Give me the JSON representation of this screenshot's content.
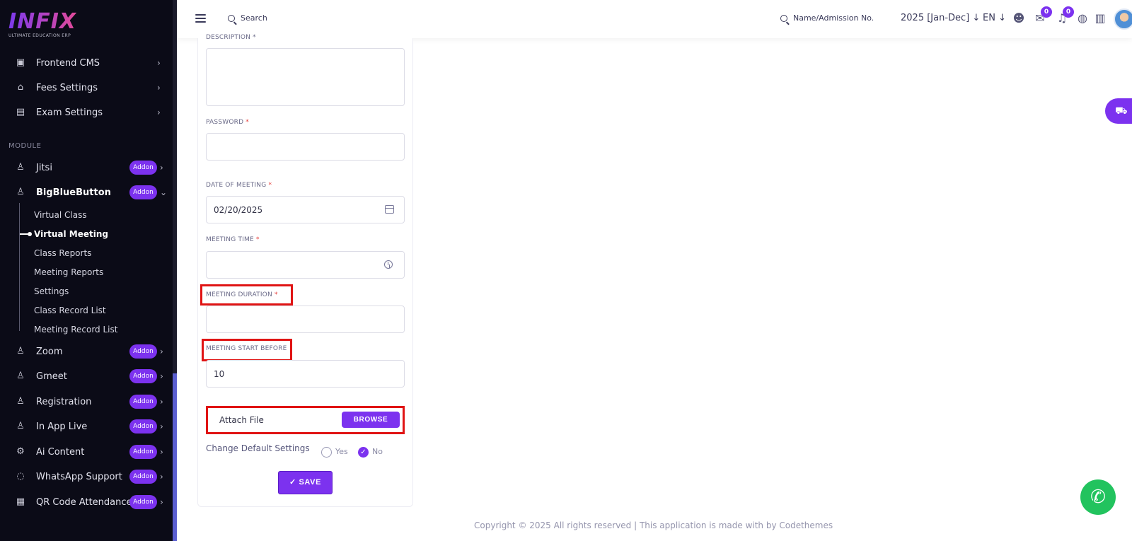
{
  "app": {
    "logo_text": "INFIX",
    "logo_tagline": "ULTIMATE EDUCATION ERP"
  },
  "sidebar": {
    "top_items": [
      {
        "label": "Frontend CMS",
        "icon": "monitor-icon"
      },
      {
        "label": "Fees Settings",
        "icon": "bank-icon"
      },
      {
        "label": "Exam Settings",
        "icon": "book-icon"
      }
    ],
    "module_label": "MODULE",
    "addon_label": "Addon",
    "modules": [
      {
        "label": "Jitsi"
      },
      {
        "label": "BigBlueButton"
      },
      {
        "label": "Zoom"
      },
      {
        "label": "Gmeet"
      },
      {
        "label": "Registration"
      },
      {
        "label": "In App Live"
      },
      {
        "label": "Ai Content"
      },
      {
        "label": "WhatsApp Support"
      },
      {
        "label": "QR Code Attendance"
      }
    ],
    "submenu": [
      {
        "label": "Virtual Class"
      },
      {
        "label": "Virtual Meeting"
      },
      {
        "label": "Class Reports"
      },
      {
        "label": "Meeting Reports"
      },
      {
        "label": "Settings"
      },
      {
        "label": "Class Record List"
      },
      {
        "label": "Meeting Record List"
      }
    ]
  },
  "topbar": {
    "search_placeholder": "Search",
    "admission_search": "Name/Admission No.",
    "academic_year": "2025 [Jan-Dec]",
    "language": "EN",
    "message_count": "0",
    "notification_count": "0"
  },
  "form": {
    "description_label": "DESCRIPTION *",
    "password_label": "PASSWORD",
    "date_label": "DATE OF MEETING",
    "date_value": "02/20/2025",
    "time_label": "MEETING TIME",
    "duration_label": "MEETING DURATION",
    "start_before_label": "MEETING START BEFORE",
    "start_before_value": "10",
    "attach_label": "Attach File",
    "browse_label": "BROWSE",
    "change_settings_label": "Change Default Settings",
    "radio_yes": "Yes",
    "radio_no": "No",
    "selected_option": "No",
    "save_label": "SAVE"
  },
  "footer": {
    "copyright": "Copyright © 2025 All rights reserved | This application is made with by Codethemes"
  },
  "colors": {
    "accent": "#7c32ef",
    "sidebar_bg": "#0b0b17",
    "highlight": "#e01414",
    "whatsapp": "#22c35e"
  }
}
